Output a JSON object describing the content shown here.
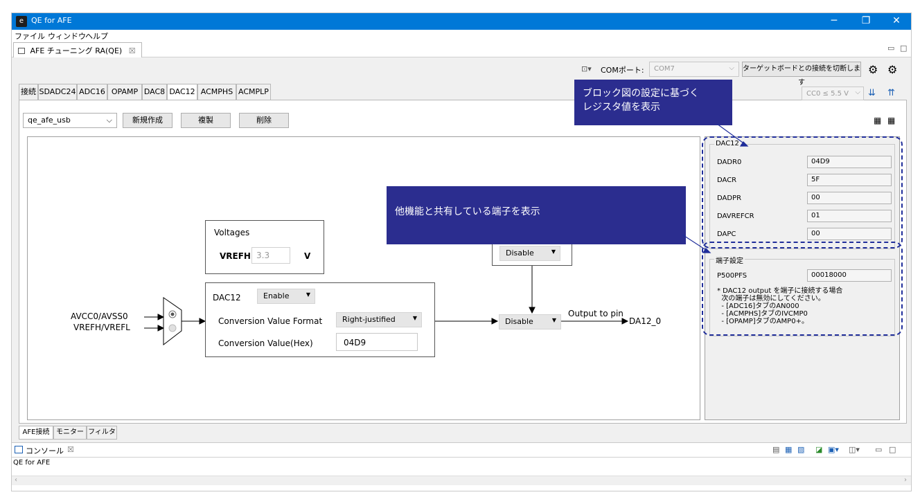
{
  "window": {
    "title": "QE for AFE",
    "min_icon": "─",
    "max_icon": "❐",
    "close_icon": "✕"
  },
  "menu": [
    "ファイル",
    "ウィンドウ",
    "ヘルプ"
  ],
  "editor_tab": {
    "label": "AFE チューニング RA(QE)",
    "close": "☒"
  },
  "toolbar": {
    "com_label": "COMポート:",
    "com_value": "COM7",
    "disconnect_label": "ターゲットボードとの接続を切断します",
    "voltage_value": "CC0 ≤ 5.5 V"
  },
  "tabs": [
    "接続",
    "SDADC24",
    "ADC16",
    "OPAMP",
    "DAC8",
    "DAC12",
    "ACMPHS",
    "ACMPLP"
  ],
  "active_tab": "DAC12",
  "config": {
    "selected": "qe_afe_usb",
    "new_label": "新規作成",
    "copy_label": "複製",
    "delete_label": "削除"
  },
  "diagram": {
    "input1": "AVCC0/AVSS0",
    "input2": "VREFH/VREFL",
    "voltages_title": "Voltages",
    "vrefh_label": "VREFH",
    "vrefh_value": "3.3",
    "vrefh_unit": "V",
    "dac_title": "DAC12",
    "dac_enable": "Enable",
    "format_label": "Conversion Value Format",
    "format_value": "Right-justified",
    "value_label": "Conversion Value(Hex)",
    "value_value": "04D9",
    "upper_disable": "Disable",
    "lower_disable": "Disable",
    "output_label": "Output to pin",
    "pin_label": "DA12_0"
  },
  "registers": {
    "group_title": "DAC12",
    "items": [
      {
        "name": "DADR0",
        "value": "04D9"
      },
      {
        "name": "DACR",
        "value": "5F"
      },
      {
        "name": "DADPR",
        "value": "00"
      },
      {
        "name": "DAVREFCR",
        "value": "01"
      },
      {
        "name": "DAPC",
        "value": "00"
      }
    ]
  },
  "pins": {
    "group_title": "端子設定",
    "name": "P500PFS",
    "value": "00018000",
    "note_lines": [
      "* DAC12 output を端子に接続する場合",
      "  次の端子は無効にしてください。",
      "  - [ADC16]タブのAN000",
      "  - [ACMPHS]タブのIVCMP0",
      "  - [OPAMP]タブのAMP0+。"
    ]
  },
  "callouts": {
    "top_line1": "ブロック図の設定に基づく",
    "top_line2": "レジスタ値を表示",
    "middle": "他機能と共有している端子を表示"
  },
  "bottom_tabs": [
    "AFE接続",
    "モニター",
    "フィルタ"
  ],
  "console": {
    "title": "コンソール",
    "close": "☒",
    "text": "QE for AFE"
  }
}
